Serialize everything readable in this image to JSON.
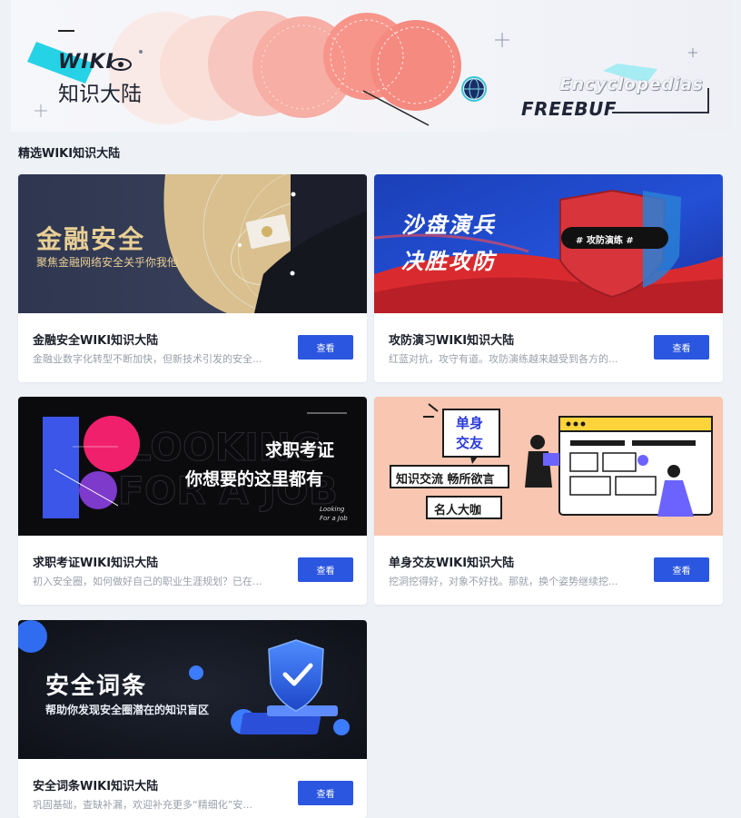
{
  "banner": {
    "logo": "WIKI",
    "subtitle": "知识大陆",
    "encyclopedias": "Encyclopedias",
    "freebuf": "FREEBUF"
  },
  "section": {
    "title": "精选WIKI知识大陆"
  },
  "cards": [
    {
      "title": "金融安全WIKI知识大陆",
      "description": "金融业数字化转型不断加快，但新技术引发的安全...",
      "button": "查看",
      "cover_title": "金融安全",
      "cover_subtitle": "聚焦金融网络安全关乎你我他"
    },
    {
      "title": "攻防演习WIKI知识大陆",
      "description": "红蓝对抗，攻守有道。攻防演练越来越受到各方的...",
      "button": "查看",
      "cover_title_1": "沙盘演兵",
      "cover_title_2": "决胜攻防",
      "cover_tag": "#  攻防演练  #"
    },
    {
      "title": "求职考证WIKI知识大陆",
      "description": "初入安全圈，如何做好自己的职业生涯规划？已在...",
      "button": "查看",
      "cover_title_1": "求职考证",
      "cover_title_2": "你想要的这里都有",
      "cover_small_1": "Looking",
      "cover_small_2": "For a Job"
    },
    {
      "title": "单身交友WIKI知识大陆",
      "description": "挖洞挖得好，对象不好找。那就，换个姿势继续挖...",
      "button": "查看",
      "cover_bubble_1": "单身",
      "cover_bubble_2": "交友",
      "cover_tag_1": "知识交流 畅所欲言",
      "cover_tag_2": "名人大咖"
    },
    {
      "title": "安全词条WIKI知识大陆",
      "description": "巩固基础，查缺补漏，欢迎补充更多“精细化”安...",
      "button": "查看",
      "cover_title": "安全词条",
      "cover_subtitle": "帮助你发现安全圈潜在的知识盲区"
    }
  ],
  "colors": {
    "accent": "#2b56e0",
    "page_bg": "#eef2f7",
    "card_bg": "#ffffff"
  }
}
